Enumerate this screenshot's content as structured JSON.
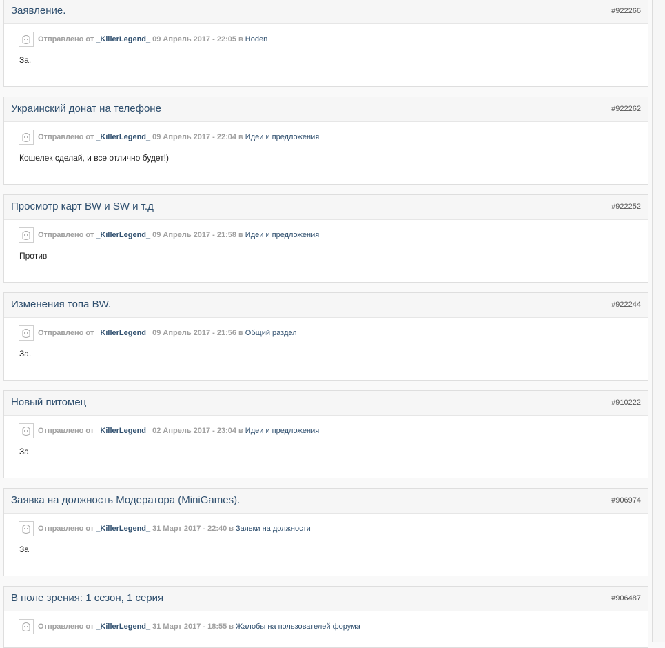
{
  "labels": {
    "sent": "Отправлено от",
    "in": "в"
  },
  "posts": [
    {
      "title": "Заявление.",
      "id": "#922266",
      "author": "_KillerLegend_",
      "date": "09 Апрель 2017 - 22:05",
      "forum": "Hoden",
      "text": "За."
    },
    {
      "title": "Украинский донат на телефоне",
      "id": "#922262",
      "author": "_KillerLegend_",
      "date": "09 Апрель 2017 - 22:04",
      "forum": "Идеи и предложения",
      "text": "Кошелек сделай, и все отлично будет!)"
    },
    {
      "title": "Просмотр карт BW и SW и т.д",
      "id": "#922252",
      "author": "_KillerLegend_",
      "date": "09 Апрель 2017 - 21:58",
      "forum": "Идеи и предложения",
      "text": "Против"
    },
    {
      "title": "Изменения топа BW.",
      "id": "#922244",
      "author": "_KillerLegend_",
      "date": "09 Апрель 2017 - 21:56",
      "forum": "Общий раздел",
      "text": "За."
    },
    {
      "title": "Новый питомец",
      "id": "#910222",
      "author": "_KillerLegend_",
      "date": "02 Апрель 2017 - 23:04",
      "forum": "Идеи и предложения",
      "text": "За"
    },
    {
      "title": "Заявка на должность Модератора (MiniGames).",
      "id": "#906974",
      "author": "_KillerLegend_",
      "date": "31 Март 2017 - 22:40",
      "forum": "Заявки на должности",
      "text": "За"
    },
    {
      "title": "В поле зрения: 1 сезон, 1 серия",
      "id": "#906487",
      "author": "_KillerLegend_",
      "date": "31 Март 2017 - 18:55",
      "forum": "Жалобы на пользователей форума",
      "text": ""
    }
  ]
}
